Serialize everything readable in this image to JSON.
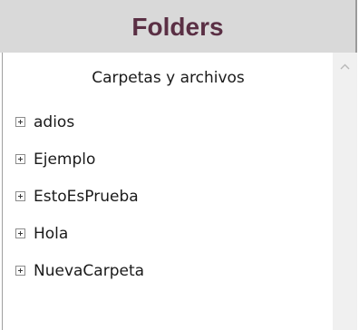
{
  "panel": {
    "title": "Folders"
  },
  "tree": {
    "caption": "Carpetas y archivos",
    "nodes": [
      {
        "label": "adios",
        "expander": "plus-expander-icon"
      },
      {
        "label": "Ejemplo",
        "expander": "plus-expander-icon"
      },
      {
        "label": "EstoEsPrueba",
        "expander": "plus-expander-icon"
      },
      {
        "label": "Hola",
        "expander": "plus-expander-icon"
      },
      {
        "label": "NuevaCarpeta",
        "expander": "plus-expander-icon"
      }
    ]
  },
  "scrollbar": {
    "up_icon": "chevron-up-icon"
  },
  "colors": {
    "header_background": "#d9d9d9",
    "title_text": "#5a2f44",
    "scrollbar_track": "#f0f0f0"
  }
}
